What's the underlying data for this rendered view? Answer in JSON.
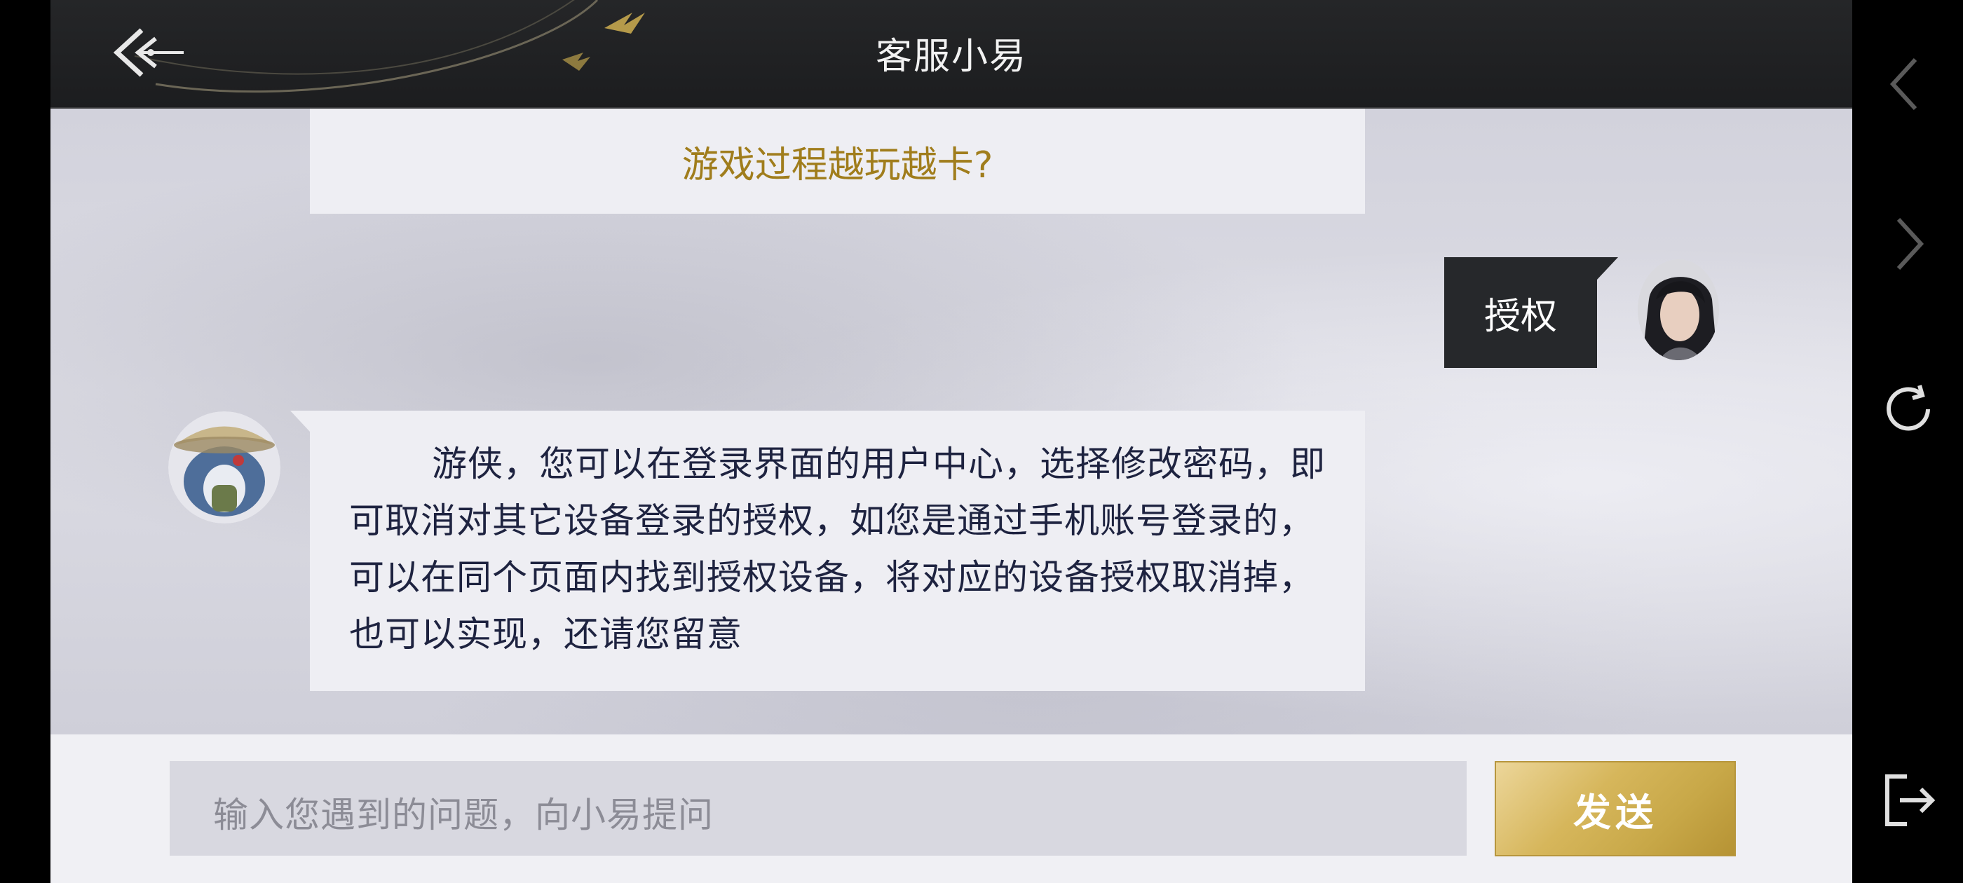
{
  "header": {
    "title": "客服小易"
  },
  "overlay": {
    "close_label": "×"
  },
  "messages": {
    "question_option": "游戏过程越玩越卡?",
    "user_message": "授权",
    "bot_reply": "游侠，您可以在登录界面的用户中心，选择修改密码，即可取消对其它设备登录的授权，如您是通过手机账号登录的，可以在同个页面内找到授权设备，将对应的设备授权取消掉，也可以实现，还请您留意"
  },
  "input": {
    "placeholder": "输入您遇到的问题，向小易提问",
    "send_label": "发送"
  },
  "side_nav": {
    "icons": [
      "chevron-left-icon",
      "chevron-right-icon",
      "refresh-icon",
      "exit-icon"
    ]
  },
  "colors": {
    "accent_gold": "#c8a848",
    "question_text": "#a07d1c",
    "bot_text": "#1e2340",
    "header_bg": "#1c1d1f"
  }
}
